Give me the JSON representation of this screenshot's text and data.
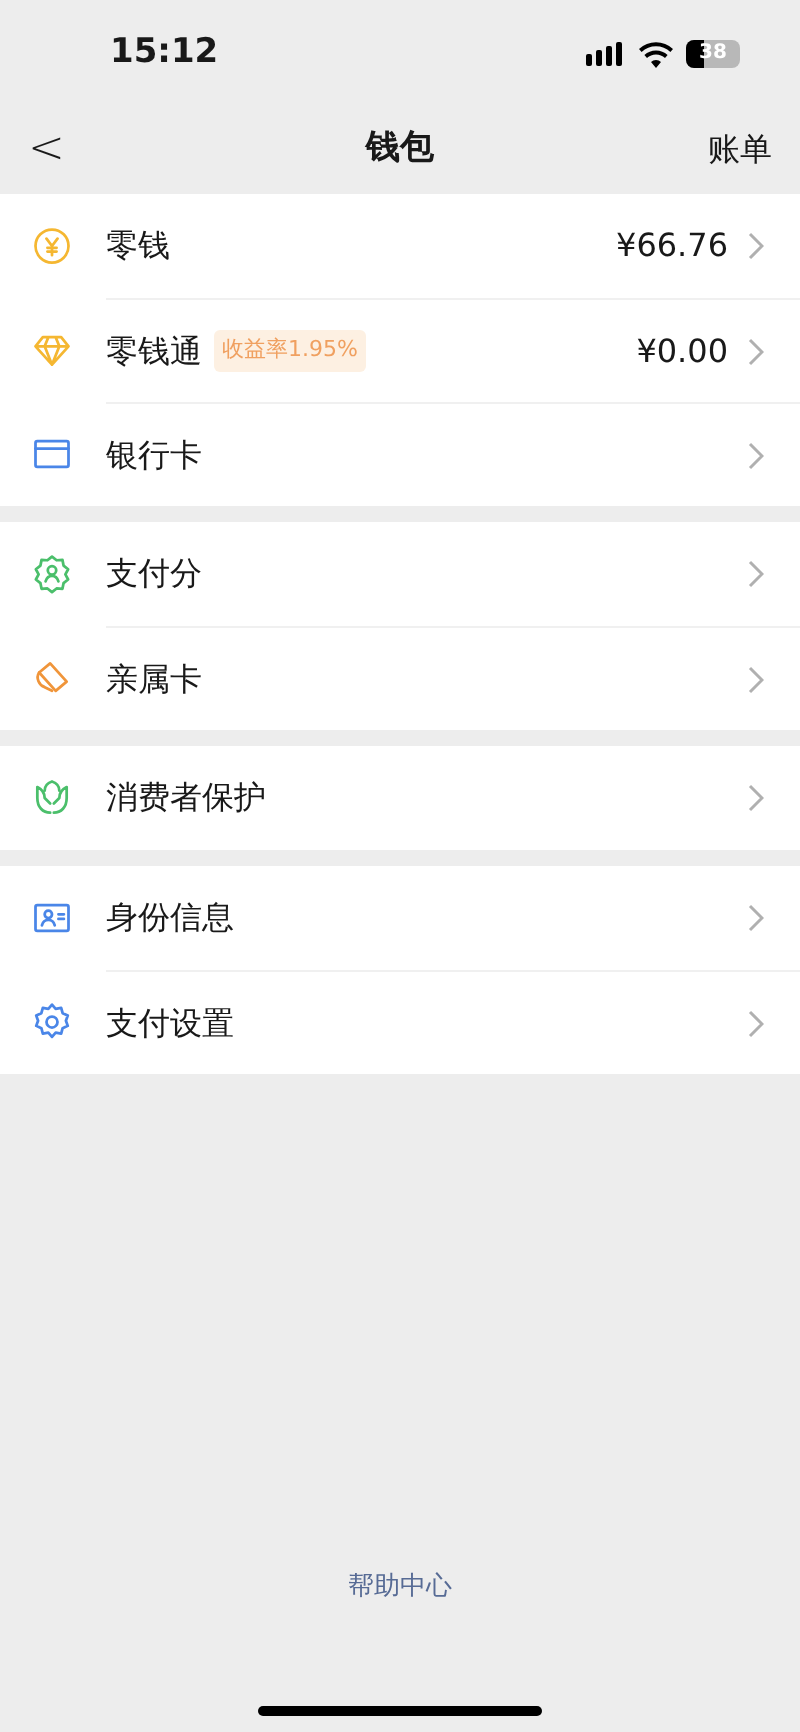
{
  "status_bar": {
    "time": "15:12",
    "battery": "38"
  },
  "nav": {
    "back": "<",
    "title": "钱包",
    "action": "账单"
  },
  "sections": [
    {
      "items": [
        {
          "label": "零钱",
          "value": "¥66.76"
        },
        {
          "label": "零钱通",
          "badge": "收益率1.95%",
          "value": "¥0.00"
        },
        {
          "label": "银行卡"
        }
      ]
    },
    {
      "items": [
        {
          "label": "支付分"
        },
        {
          "label": "亲属卡"
        }
      ]
    },
    {
      "items": [
        {
          "label": "消费者保护"
        }
      ]
    },
    {
      "items": [
        {
          "label": "身份信息"
        },
        {
          "label": "支付设置"
        }
      ]
    }
  ],
  "footer": {
    "link": "帮助中心"
  }
}
